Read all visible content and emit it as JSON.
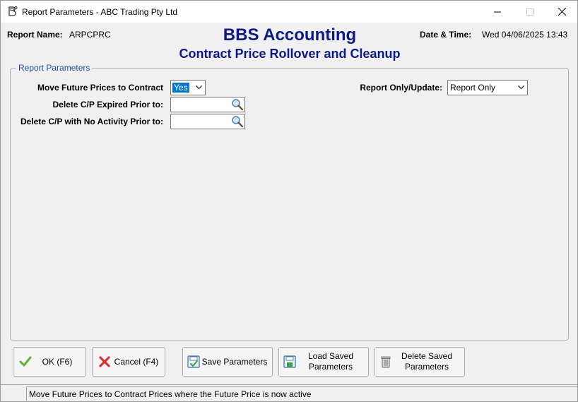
{
  "window": {
    "title": "Report Parameters - ABC Trading Pty Ltd"
  },
  "header": {
    "report_name_label": "Report Name:",
    "report_name_value": "ARPCPRC",
    "company": "BBS Accounting",
    "report_title": "Contract Price Rollover and Cleanup",
    "datetime_label": "Date & Time:",
    "datetime_value": "Wed 04/06/2025 13:43"
  },
  "parameters": {
    "group_label": "Report Parameters",
    "move_future_label": "Move Future Prices to Contract",
    "move_future_value": "Yes",
    "delete_expired_label": "Delete C/P Expired Prior to:",
    "delete_expired_value": "",
    "delete_no_activity_label": "Delete C/P with No Activity Prior to:",
    "delete_no_activity_value": "",
    "report_update_label": "Report Only/Update:",
    "report_update_value": "Report Only"
  },
  "buttons": {
    "ok": "OK (F6)",
    "cancel": "Cancel (F4)",
    "save": "Save Parameters",
    "load_line1": "Load Saved",
    "load_line2": "Parameters",
    "delete_line1": "Delete Saved",
    "delete_line2": "Parameters"
  },
  "status": {
    "message": "Move Future Prices to Contract Prices where the Future Price is now active"
  },
  "icons": {
    "app": "app-logo-icon",
    "minimize": "minimize-icon",
    "maximize": "maximize-icon",
    "close": "close-icon",
    "lookup": "magnifier-icon",
    "dropdown": "chevron-down-icon",
    "ok": "checkmark-icon",
    "cancel": "cross-icon",
    "save": "save-params-icon",
    "load": "load-params-icon",
    "delete": "trash-icon"
  },
  "colors": {
    "title_blue": "#0b1a8a",
    "legend_blue": "#1c4fa0",
    "selection": "#0078d7",
    "ok_green": "#5bb52a",
    "cancel_red": "#d9342b"
  }
}
